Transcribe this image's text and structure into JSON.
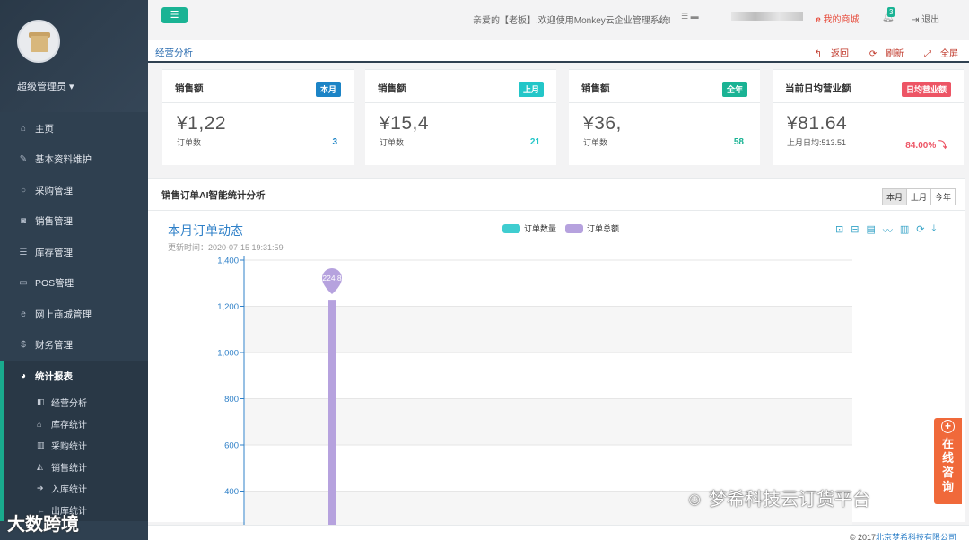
{
  "sidebar": {
    "role": "超级管理员 ▾",
    "items": [
      {
        "label": "主页",
        "icon": "home-icon"
      },
      {
        "label": "基本资料维护",
        "icon": "pencil-icon"
      },
      {
        "label": "采购管理",
        "icon": "circle-icon"
      },
      {
        "label": "销售管理",
        "icon": "camera-icon"
      },
      {
        "label": "库存管理",
        "icon": "database-icon"
      },
      {
        "label": "POS管理",
        "icon": "monitor-icon"
      },
      {
        "label": "网上商城管理",
        "icon": "ie-icon"
      },
      {
        "label": "财务管理",
        "icon": "dollar-icon"
      }
    ],
    "active_item": {
      "label": "统计报表",
      "icon": "pie-chart-icon"
    },
    "sub_items": [
      {
        "label": "经营分析",
        "icon": "binoculars-icon"
      },
      {
        "label": "库存统计",
        "icon": "bank-icon"
      },
      {
        "label": "采购统计",
        "icon": "bar-chart-icon"
      },
      {
        "label": "销售统计",
        "icon": "area-chart-icon"
      },
      {
        "label": "入库统计",
        "icon": "arrow-right-icon"
      },
      {
        "label": "出库统计",
        "icon": "arrow-left-icon"
      }
    ]
  },
  "topbar": {
    "welcome": "亲爱的【老板】,欢迎使用Monkey云企业管理系统!",
    "mall": "我的商城",
    "badge": "3",
    "logout": "退出"
  },
  "tabbar": {
    "title": "经营分析",
    "back": "返回",
    "refresh": "刷新",
    "fullscreen": "全屏"
  },
  "cards": [
    {
      "title": "销售额",
      "label": "本月",
      "color": "#23c6c8",
      "label_color": "#1c84c6",
      "value": "¥1,22",
      "sub": "订单数",
      "count": "3",
      "count_color": "#1c84c6"
    },
    {
      "title": "销售额",
      "label": "上月",
      "color": "#23c6c8",
      "label_color": "#23c6c8",
      "value": "¥15,4",
      "sub": "订单数",
      "count": "21",
      "count_color": "#23c6c8"
    },
    {
      "title": "销售额",
      "label": "全年",
      "color": "#1ab394",
      "label_color": "#1ab394",
      "value": "¥36,",
      "sub": "订单数",
      "count": "58",
      "count_color": "#1ab394"
    },
    {
      "title": "当前日均营业额",
      "label": "日均营业额",
      "color": "#ed5565",
      "label_color": "#ed5565",
      "value": "¥81.64",
      "sub": "上月日均:513.51",
      "count": "84.00% ⤵",
      "count_color": "#ed5565"
    }
  ],
  "analysis": {
    "title": "销售订单AI智能统计分析",
    "ranges": [
      "本月",
      "上月",
      "今年"
    ],
    "chart_title": "本月订单动态",
    "updated": "更新时间：2020-07-15 19:31:59",
    "legend": [
      "订单数量",
      "订单总额"
    ],
    "tool_icons": [
      "zoom-icon",
      "zoom-reset-icon",
      "data-view-icon",
      "line-chart-icon",
      "bar-chart-icon",
      "restore-icon",
      "download-icon"
    ]
  },
  "colors": {
    "series1": "#3fcdd0",
    "series2": "#b6a2de",
    "accent": "#1ab394"
  },
  "chart_data": {
    "type": "bar",
    "title": "本月订单动态",
    "series": [
      {
        "name": "订单数量",
        "values": [
          0
        ]
      },
      {
        "name": "订单总额",
        "values": [
          1224.8
        ]
      }
    ],
    "yticks": [
      "1,400",
      "1,200",
      "1,000",
      "800",
      "600",
      "400"
    ],
    "ylim": [
      200,
      1400
    ],
    "marker_label": "224.8"
  },
  "footer": {
    "copyright": "© 2017",
    "company": "北京梦希科技有限公司"
  },
  "consult": {
    "label": "在线咨询"
  },
  "watermarks": {
    "wechat": "梦希科技云订货平台",
    "corner": "大数跨境"
  }
}
